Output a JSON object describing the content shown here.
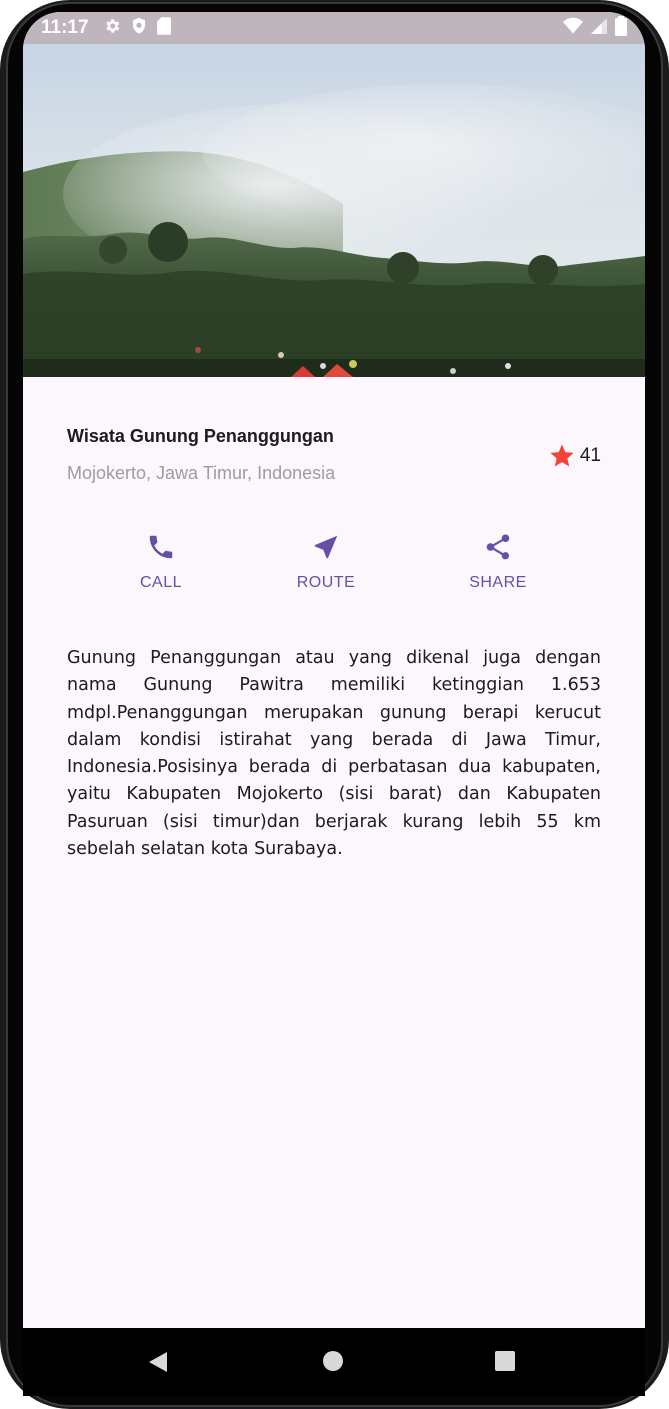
{
  "status_bar": {
    "time": "11:17",
    "left_icons": [
      "gear-icon",
      "shield-icon",
      "sd-card-icon"
    ],
    "right_icons": [
      "wifi-icon",
      "signal-icon",
      "battery-icon"
    ]
  },
  "place": {
    "name": "Wisata Gunung Penanggungan",
    "location": "Mojokerto, Jawa Timur, Indonesia",
    "rating": "41"
  },
  "actions": [
    {
      "label": "CALL",
      "icon": "phone-icon"
    },
    {
      "label": "ROUTE",
      "icon": "navigation-icon"
    },
    {
      "label": "SHARE",
      "icon": "share-icon"
    }
  ],
  "description": "Gunung Penanggungan atau yang dikenal juga dengan nama Gunung Pawitra memiliki ketinggian 1.653 mdpl.Penanggungan merupakan gunung berapi kerucut dalam kondisi istirahat yang berada di Jawa Timur, Indonesia.Posisinya berada di perbatasan dua kabupaten, yaitu Kabupaten Mojokerto (sisi barat) dan Kabupaten Pasuruan (sisi timur)dan berjarak kurang lebih 55 km sebelah selatan kota Surabaya.",
  "colors": {
    "accent": "#6750a4",
    "star": "#f44336",
    "background": "#fcf6fd",
    "secondary_text": "#a09aa3"
  },
  "nav_bar": {
    "icons": [
      "back-icon",
      "home-icon",
      "recents-icon"
    ]
  }
}
